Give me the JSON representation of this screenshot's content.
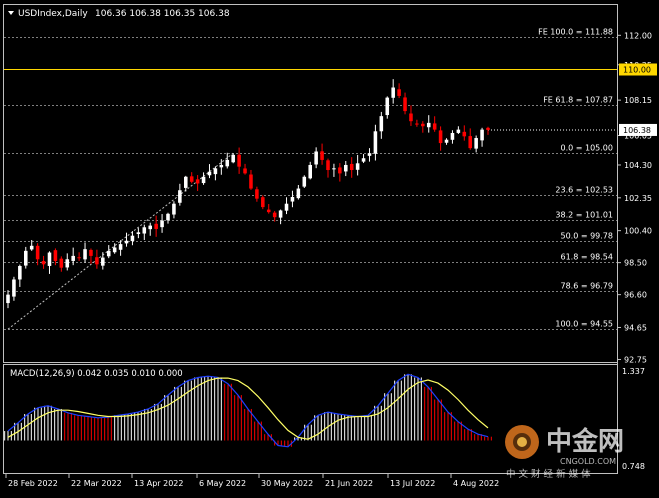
{
  "header": {
    "symbol": "USDIndex,Daily",
    "ohlc": "106.36 106.38 106.35 106.38"
  },
  "macd": {
    "label": "MACD(12,26,9) 0.042 0.035 0.010 0.000",
    "axis_labels": [
      "1.337",
      "0.748"
    ]
  },
  "watermark": {
    "brand": "中金网",
    "domain": "CNGOLD.COM",
    "tagline": "中 文 财 经 新 媒 体"
  },
  "colors": {
    "bull": "#ffffff",
    "bear": "#ff0000",
    "grid": "#7f7f7f",
    "resistance": "#ffd700",
    "macd_main": "#1f3fff",
    "macd_signal": "#ffff66",
    "price_box": "#ffffff"
  },
  "chart_data": {
    "type": "candlestick",
    "title": "USDIndex,Daily",
    "y_ticks": [
      "112.00",
      "110.25",
      "108.15",
      "106.05",
      "104.30",
      "102.35",
      "100.40",
      "98.50",
      "96.60",
      "94.65",
      "92.75"
    ],
    "y_tick_values": [
      112.0,
      110.25,
      108.15,
      106.05,
      104.3,
      102.35,
      100.4,
      98.5,
      96.6,
      94.65,
      92.75
    ],
    "ylim": [
      92.6,
      113.8
    ],
    "x_ticks": [
      "28 Feb 2022",
      "22 Mar 2022",
      "13 Apr 2022",
      "6 May 2022",
      "30 May 2022",
      "21 Jun 2022",
      "13 Jul 2022",
      "4 Aug 2022"
    ],
    "current_price": "106.38",
    "current_value": 106.38,
    "resistance_label": "110.00",
    "resistance_value": 110.0,
    "fib_levels": [
      {
        "label": "FE 100.0 = 111.88",
        "value": 111.88
      },
      {
        "label": "FE 61.8 = 107.87",
        "value": 107.87
      },
      {
        "label": "0.0 = 105.00",
        "value": 105.0
      },
      {
        "label": "23.6 = 102.53",
        "value": 102.53
      },
      {
        "label": "38.2 = 101.01",
        "value": 101.01
      },
      {
        "label": "50.0 = 99.78",
        "value": 99.78
      },
      {
        "label": "61.8 = 98.54",
        "value": 98.54
      },
      {
        "label": "78.6 = 96.79",
        "value": 96.79
      },
      {
        "label": "100.0 = 94.55",
        "value": 94.55
      }
    ],
    "trendline": {
      "from": 94.55,
      "to": 105.0
    },
    "close_path": [
      96.6,
      97.5,
      98.3,
      99.2,
      99.5,
      98.7,
      98.4,
      99.1,
      98.6,
      98.2,
      98.7,
      98.9,
      98.8,
      99.3,
      98.9,
      98.4,
      98.8,
      99.2,
      99.4,
      99.6,
      99.8,
      100.1,
      100.3,
      100.6,
      100.7,
      100.5,
      101.0,
      101.4,
      102.0,
      102.8,
      103.6,
      103.3,
      103.2,
      103.6,
      103.9,
      104.1,
      104.3,
      104.6,
      104.9,
      104.2,
      103.8,
      102.9,
      102.3,
      101.8,
      101.5,
      101.2,
      101.6,
      102.0,
      102.4,
      102.9,
      103.6,
      104.3,
      105.1,
      104.6,
      104.0,
      104.1,
      103.8,
      104.3,
      104.0,
      104.4,
      104.7,
      105.0,
      106.3,
      107.2,
      108.3,
      108.9,
      108.4,
      107.5,
      106.9,
      106.7,
      106.6,
      106.8,
      106.4,
      105.6,
      105.8,
      106.2,
      106.4,
      106.0,
      105.3,
      105.9,
      106.4,
      106.38
    ],
    "macd_main": [
      0.15,
      0.28,
      0.42,
      0.52,
      0.55,
      0.5,
      0.44,
      0.4,
      0.38,
      0.36,
      0.37,
      0.4,
      0.42,
      0.45,
      0.5,
      0.58,
      0.72,
      0.85,
      0.95,
      1.0,
      1.02,
      1.0,
      0.9,
      0.72,
      0.5,
      0.3,
      0.1,
      -0.08,
      -0.1,
      0.05,
      0.25,
      0.4,
      0.45,
      0.42,
      0.4,
      0.38,
      0.4,
      0.55,
      0.75,
      0.95,
      1.05,
      1.0,
      0.85,
      0.65,
      0.45,
      0.3,
      0.18,
      0.1,
      0.06
    ],
    "macd_signal": [
      0.05,
      0.14,
      0.25,
      0.36,
      0.44,
      0.48,
      0.48,
      0.46,
      0.43,
      0.4,
      0.38,
      0.38,
      0.39,
      0.41,
      0.44,
      0.49,
      0.56,
      0.66,
      0.77,
      0.87,
      0.95,
      0.99,
      0.99,
      0.95,
      0.85,
      0.7,
      0.52,
      0.33,
      0.16,
      0.05,
      0.02,
      0.1,
      0.22,
      0.32,
      0.37,
      0.38,
      0.38,
      0.42,
      0.52,
      0.66,
      0.81,
      0.92,
      0.96,
      0.91,
      0.8,
      0.65,
      0.48,
      0.33,
      0.2
    ],
    "macd_ylim": [
      -0.5,
      1.15
    ]
  }
}
